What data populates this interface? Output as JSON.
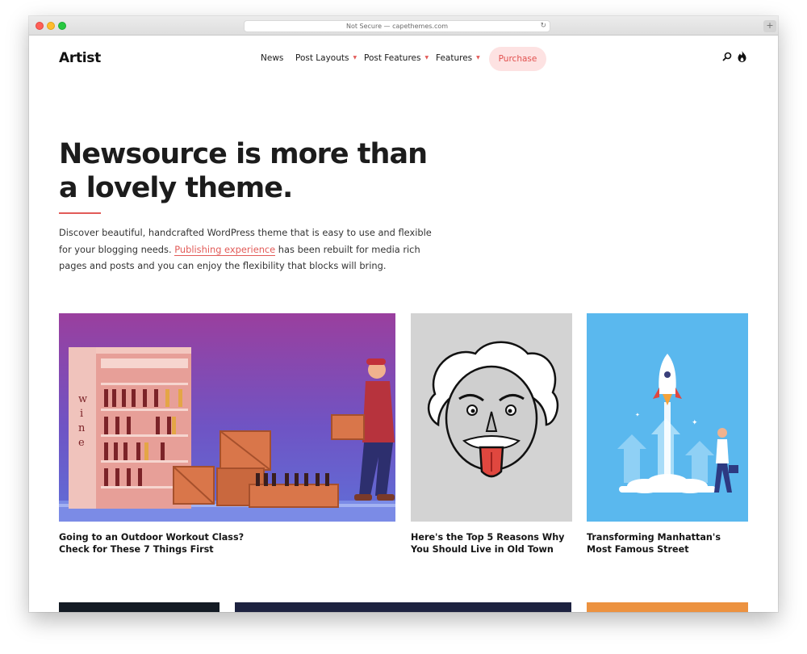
{
  "browser": {
    "url": "Not Secure — capethemes.com",
    "reload_icon": "reload-icon",
    "new_tab_icon": "plus-icon"
  },
  "site": {
    "logo": "Artist",
    "nav": [
      {
        "label": "News",
        "has_dropdown": false
      },
      {
        "label": "Post Layouts",
        "has_dropdown": true
      },
      {
        "label": "Post Features",
        "has_dropdown": true
      },
      {
        "label": "Features",
        "has_dropdown": true
      }
    ],
    "purchase_label": "Purchase",
    "header_icons": [
      "search-icon",
      "flame-icon"
    ],
    "accent_color": "#e25b58"
  },
  "hero": {
    "title": "Newsource is more than a lovely theme.",
    "description_before": "Discover beautiful, handcrafted WordPress theme that is easy to use and flexible for your blogging needs. ",
    "description_link": "Publishing experience",
    "description_after": " has been rebuilt for media rich pages and posts and you can enjoy the flexibility that blocks will bring."
  },
  "posts": [
    {
      "title": "Going to an Outdoor Workout Class? Check for These 7 Things First",
      "image": "wine shop illustration"
    },
    {
      "title": "Here's the Top 5 Reasons Why You Should Live in Old Town",
      "image": "einstein illustration"
    },
    {
      "title": "Transforming Manhattan's Most Famous Street",
      "image": "rocket launch illustration"
    }
  ]
}
